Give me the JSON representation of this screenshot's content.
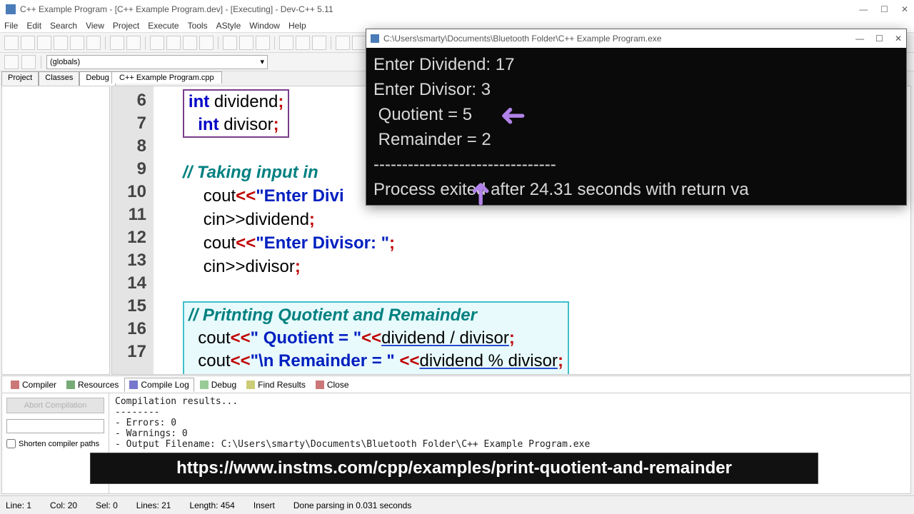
{
  "title": "C++ Example Program - [C++ Example Program.dev] - [Executing] - Dev-C++ 5.11",
  "window_buttons": [
    "—",
    "☐",
    "✕"
  ],
  "menus": [
    "File",
    "Edit",
    "Search",
    "View",
    "Project",
    "Execute",
    "Tools",
    "AStyle",
    "Window",
    "Help"
  ],
  "globals": "(globals)",
  "side_tabs": [
    "Project",
    "Classes",
    "Debug"
  ],
  "active_side_tab": "Debug",
  "file_tab": "C++ Example Program.cpp",
  "line_numbers": [
    "6",
    "7",
    "8",
    "9",
    "10",
    "11",
    "12",
    "13",
    "14",
    "15",
    "16",
    "17"
  ],
  "code": {
    "l6a": "int",
    "l6b": " dividend",
    "l6s": ";",
    "l7a": "int",
    "l7b": " divisor",
    "l7s": ";",
    "l9": "// Taking input in",
    "l10a": "cout",
    "l10b": "<<",
    "l10c": "\"Enter Divi",
    "l11": "cin>>dividend",
    "l11s": ";",
    "l12a": "cout",
    "l12b": "<<",
    "l12c": "\"Enter Divisor: \"",
    "l12s": ";",
    "l13": "cin>>divisor",
    "l13s": ";",
    "l15": "// Pritnting Quotient and Remainder",
    "l16a": "cout",
    "l16b": "<<",
    "l16c": "\" Quotient = \"",
    "l16d": "<<",
    "l16e": "dividend / divisor",
    "l16s": ";",
    "l17a": "cout",
    "l17b": "<<",
    "l17c": "\"\\n Remainder = \"",
    "l17d": " <<",
    "l17e": "dividend % divisor",
    "l17s": ";"
  },
  "bottom_tabs": [
    "Compiler",
    "Resources",
    "Compile Log",
    "Debug",
    "Find Results",
    "Close"
  ],
  "active_bottom_tab": "Compile Log",
  "abort_btn": "Abort Compilation",
  "shorten_chk": "Shorten compiler paths",
  "compile_log": "Compilation results...\n--------\n- Errors: 0\n- Warnings: 0\n- Output Filename: C:\\Users\\smarty\\Documents\\Bluetooth Folder\\C++ Example Program.exe",
  "status": {
    "line": "Line:   1",
    "col": "Col:   20",
    "sel": "Sel:   0",
    "lines": "Lines:   21",
    "length": "Length:   454",
    "insert": "Insert",
    "done": "Done parsing in 0.031 seconds"
  },
  "console": {
    "title": "C:\\Users\\smarty\\Documents\\Bluetooth Folder\\C++ Example Program.exe",
    "window_buttons": [
      "—",
      "☐",
      "✕"
    ],
    "lines": [
      "Enter Dividend: 17",
      "Enter Divisor: 3",
      " Quotient = 5",
      " Remainder = 2",
      "--------------------------------",
      "Process exited after 24.31 seconds with return va"
    ]
  },
  "url_banner": "https://www.instms.com/cpp/examples/print-quotient-and-remainder"
}
